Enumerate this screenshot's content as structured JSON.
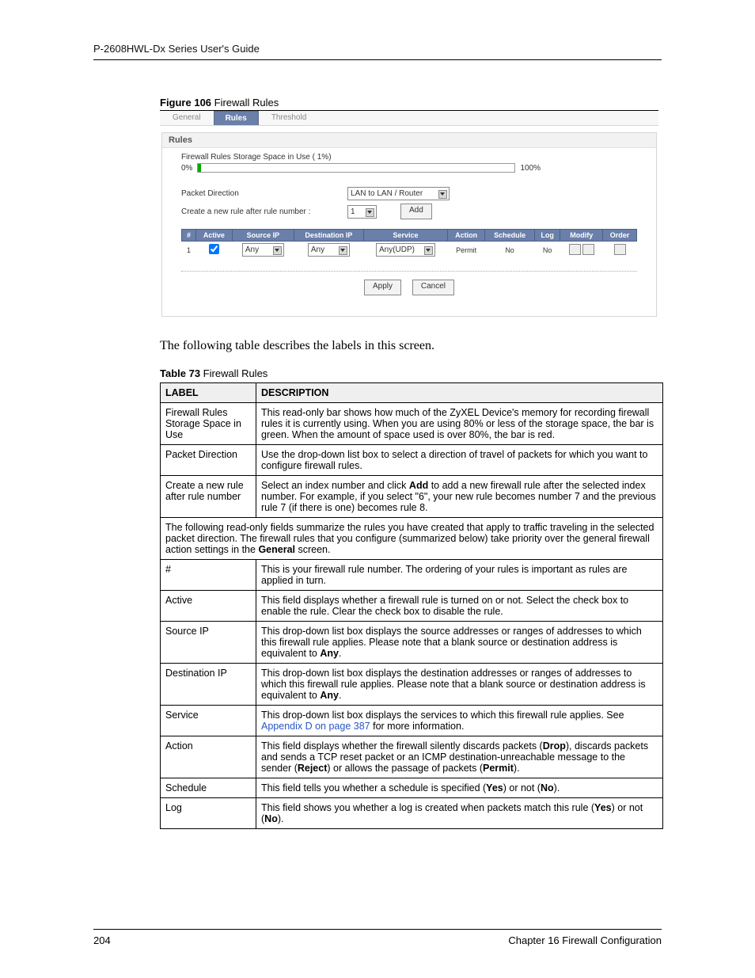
{
  "running_head": "P-2608HWL-Dx Series User's Guide",
  "figure_caption_bold": "Figure 106",
  "figure_caption_rest": "   Firewall Rules",
  "shot": {
    "tabs": {
      "general": "General",
      "rules": "Rules",
      "threshold": "Threshold"
    },
    "panel_title": "Rules",
    "storage_label": "Firewall Rules Storage Space in Use  ( 1%)",
    "bar_left": "0%",
    "bar_right": "100%",
    "packet_direction_label": "Packet Direction",
    "packet_direction_value": "LAN to LAN / Router",
    "create_rule_label": "Create a new rule after rule number :",
    "rule_number_value": "1",
    "add_btn": "Add",
    "headers": {
      "num": "#",
      "active": "Active",
      "source": "Source IP",
      "dest": "Destination IP",
      "service": "Service",
      "action": "Action",
      "schedule": "Schedule",
      "log": "Log",
      "modify": "Modify",
      "order": "Order"
    },
    "row1": {
      "num": "1",
      "source": "Any",
      "dest": "Any",
      "service": "Any(UDP)",
      "action": "Permit",
      "schedule": "No",
      "log": "No"
    },
    "apply_btn": "Apply",
    "cancel_btn": "Cancel"
  },
  "leadin": "The following table describes the labels in this screen.",
  "table_caption_bold": "Table 73",
  "table_caption_rest": "   Firewall Rules",
  "desc": {
    "head_label": "LABEL",
    "head_desc": "DESCRIPTION",
    "rows": [
      {
        "label": "Firewall Rules Storage Space in Use",
        "desc": "This read-only bar shows how much of the ZyXEL Device's memory for recording firewall rules it is currently using. When you are using 80% or less of the storage space, the bar is green. When the amount of space used is over 80%, the bar is red."
      },
      {
        "label": "Packet Direction",
        "desc": "Use the drop-down list box to select a direction of travel of packets for which you want to configure firewall rules."
      },
      {
        "label": "Create a new rule after rule number",
        "desc_pre": "Select an index number and click ",
        "desc_bold1": "Add",
        "desc_post": " to add a new firewall rule after the selected index number. For example, if you select \"6\", your new rule becomes number 7 and the previous rule 7 (if there is one) becomes rule 8."
      }
    ],
    "fullrow_pre": "The following read-only fields summarize the rules you have created that apply to traffic traveling in the selected packet direction. The firewall rules that you configure (summarized below) take priority over the general firewall action settings in the ",
    "fullrow_bold": "General",
    "fullrow_post": " screen.",
    "rows2": [
      {
        "label": "#",
        "desc": "This is your firewall rule number. The ordering of your rules is important as rules are applied in turn."
      },
      {
        "label": "Active",
        "desc": "This field displays whether a firewall rule is turned on or not. Select the check box to enable the rule. Clear the check box to disable the rule."
      },
      {
        "label": "Source IP",
        "desc_pre": "This drop-down list box displays the source addresses or ranges of addresses to which this firewall rule applies. Please note that a blank source or destination address is equivalent to ",
        "desc_bold": "Any",
        "desc_post": "."
      },
      {
        "label": "Destination IP",
        "desc_pre": "This drop-down list box displays the destination addresses or ranges of addresses to which this firewall rule applies. Please note that a blank source or destination address is equivalent to ",
        "desc_bold": "Any",
        "desc_post": "."
      },
      {
        "label": "Service",
        "desc_pre": "This drop-down list box displays the services to which this firewall rule applies. See ",
        "desc_link": "Appendix D on page 387",
        "desc_post": " for more information."
      },
      {
        "label": "Action",
        "desc_pre": "This field displays whether the firewall silently discards packets (",
        "b1": "Drop",
        "mid1": "), discards packets and sends a TCP reset packet or an ICMP destination-unreachable message to the sender (",
        "b2": "Reject",
        "mid2": ") or allows the passage of packets (",
        "b3": "Permit",
        "post": ")."
      },
      {
        "label": "Schedule",
        "desc_pre": "This field tells you whether a schedule is specified (",
        "b1": "Yes",
        "mid1": ") or not (",
        "b2": "No",
        "post": ")."
      },
      {
        "label": "Log",
        "desc_pre": "This field shows you whether a log is created when packets match this rule (",
        "b1": "Yes",
        "mid1": ") or not (",
        "b2": "No",
        "post": ")."
      }
    ]
  },
  "footer_left": "204",
  "footer_right": "Chapter 16 Firewall Configuration"
}
